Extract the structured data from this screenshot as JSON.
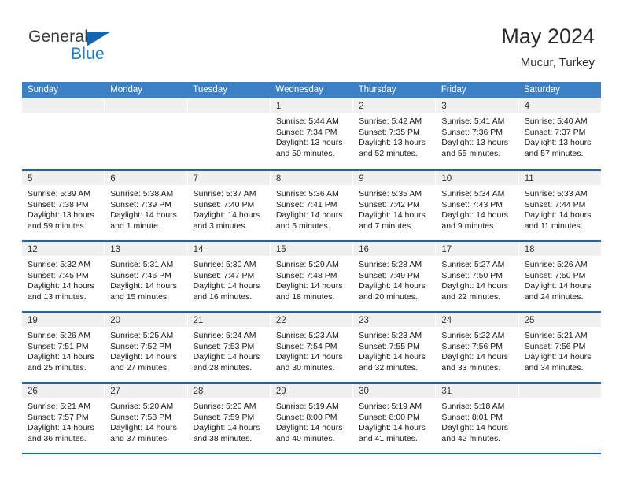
{
  "brand": {
    "name_top": "General",
    "name_bottom": "Blue",
    "triangle_color": "#1565b0",
    "blue_color": "#1c7fd4"
  },
  "header": {
    "title": "May 2024",
    "subtitle": "Mucur, Turkey"
  },
  "theme": {
    "header_row_bg": "#3b7fc4",
    "row_rule": "#1565b0",
    "day_band_bg": "#f0f0f0",
    "text": "#1a1a1a"
  },
  "weekdays": [
    "Sunday",
    "Monday",
    "Tuesday",
    "Wednesday",
    "Thursday",
    "Friday",
    "Saturday"
  ],
  "labels": {
    "sunrise_prefix": "Sunrise:",
    "sunset_prefix": "Sunset:",
    "daylight_prefix": "Daylight:"
  },
  "weeks": [
    [
      {
        "day": "",
        "empty": true
      },
      {
        "day": "",
        "empty": true
      },
      {
        "day": "",
        "empty": true
      },
      {
        "day": "1",
        "sunrise": "Sunrise: 5:44 AM",
        "sunset": "Sunset: 7:34 PM",
        "daylight_l1": "Daylight: 13 hours",
        "daylight_l2": "and 50 minutes."
      },
      {
        "day": "2",
        "sunrise": "Sunrise: 5:42 AM",
        "sunset": "Sunset: 7:35 PM",
        "daylight_l1": "Daylight: 13 hours",
        "daylight_l2": "and 52 minutes."
      },
      {
        "day": "3",
        "sunrise": "Sunrise: 5:41 AM",
        "sunset": "Sunset: 7:36 PM",
        "daylight_l1": "Daylight: 13 hours",
        "daylight_l2": "and 55 minutes."
      },
      {
        "day": "4",
        "sunrise": "Sunrise: 5:40 AM",
        "sunset": "Sunset: 7:37 PM",
        "daylight_l1": "Daylight: 13 hours",
        "daylight_l2": "and 57 minutes."
      }
    ],
    [
      {
        "day": "5",
        "sunrise": "Sunrise: 5:39 AM",
        "sunset": "Sunset: 7:38 PM",
        "daylight_l1": "Daylight: 13 hours",
        "daylight_l2": "and 59 minutes."
      },
      {
        "day": "6",
        "sunrise": "Sunrise: 5:38 AM",
        "sunset": "Sunset: 7:39 PM",
        "daylight_l1": "Daylight: 14 hours",
        "daylight_l2": "and 1 minute."
      },
      {
        "day": "7",
        "sunrise": "Sunrise: 5:37 AM",
        "sunset": "Sunset: 7:40 PM",
        "daylight_l1": "Daylight: 14 hours",
        "daylight_l2": "and 3 minutes."
      },
      {
        "day": "8",
        "sunrise": "Sunrise: 5:36 AM",
        "sunset": "Sunset: 7:41 PM",
        "daylight_l1": "Daylight: 14 hours",
        "daylight_l2": "and 5 minutes."
      },
      {
        "day": "9",
        "sunrise": "Sunrise: 5:35 AM",
        "sunset": "Sunset: 7:42 PM",
        "daylight_l1": "Daylight: 14 hours",
        "daylight_l2": "and 7 minutes."
      },
      {
        "day": "10",
        "sunrise": "Sunrise: 5:34 AM",
        "sunset": "Sunset: 7:43 PM",
        "daylight_l1": "Daylight: 14 hours",
        "daylight_l2": "and 9 minutes."
      },
      {
        "day": "11",
        "sunrise": "Sunrise: 5:33 AM",
        "sunset": "Sunset: 7:44 PM",
        "daylight_l1": "Daylight: 14 hours",
        "daylight_l2": "and 11 minutes."
      }
    ],
    [
      {
        "day": "12",
        "sunrise": "Sunrise: 5:32 AM",
        "sunset": "Sunset: 7:45 PM",
        "daylight_l1": "Daylight: 14 hours",
        "daylight_l2": "and 13 minutes."
      },
      {
        "day": "13",
        "sunrise": "Sunrise: 5:31 AM",
        "sunset": "Sunset: 7:46 PM",
        "daylight_l1": "Daylight: 14 hours",
        "daylight_l2": "and 15 minutes."
      },
      {
        "day": "14",
        "sunrise": "Sunrise: 5:30 AM",
        "sunset": "Sunset: 7:47 PM",
        "daylight_l1": "Daylight: 14 hours",
        "daylight_l2": "and 16 minutes."
      },
      {
        "day": "15",
        "sunrise": "Sunrise: 5:29 AM",
        "sunset": "Sunset: 7:48 PM",
        "daylight_l1": "Daylight: 14 hours",
        "daylight_l2": "and 18 minutes."
      },
      {
        "day": "16",
        "sunrise": "Sunrise: 5:28 AM",
        "sunset": "Sunset: 7:49 PM",
        "daylight_l1": "Daylight: 14 hours",
        "daylight_l2": "and 20 minutes."
      },
      {
        "day": "17",
        "sunrise": "Sunrise: 5:27 AM",
        "sunset": "Sunset: 7:50 PM",
        "daylight_l1": "Daylight: 14 hours",
        "daylight_l2": "and 22 minutes."
      },
      {
        "day": "18",
        "sunrise": "Sunrise: 5:26 AM",
        "sunset": "Sunset: 7:50 PM",
        "daylight_l1": "Daylight: 14 hours",
        "daylight_l2": "and 24 minutes."
      }
    ],
    [
      {
        "day": "19",
        "sunrise": "Sunrise: 5:26 AM",
        "sunset": "Sunset: 7:51 PM",
        "daylight_l1": "Daylight: 14 hours",
        "daylight_l2": "and 25 minutes."
      },
      {
        "day": "20",
        "sunrise": "Sunrise: 5:25 AM",
        "sunset": "Sunset: 7:52 PM",
        "daylight_l1": "Daylight: 14 hours",
        "daylight_l2": "and 27 minutes."
      },
      {
        "day": "21",
        "sunrise": "Sunrise: 5:24 AM",
        "sunset": "Sunset: 7:53 PM",
        "daylight_l1": "Daylight: 14 hours",
        "daylight_l2": "and 28 minutes."
      },
      {
        "day": "22",
        "sunrise": "Sunrise: 5:23 AM",
        "sunset": "Sunset: 7:54 PM",
        "daylight_l1": "Daylight: 14 hours",
        "daylight_l2": "and 30 minutes."
      },
      {
        "day": "23",
        "sunrise": "Sunrise: 5:23 AM",
        "sunset": "Sunset: 7:55 PM",
        "daylight_l1": "Daylight: 14 hours",
        "daylight_l2": "and 32 minutes."
      },
      {
        "day": "24",
        "sunrise": "Sunrise: 5:22 AM",
        "sunset": "Sunset: 7:56 PM",
        "daylight_l1": "Daylight: 14 hours",
        "daylight_l2": "and 33 minutes."
      },
      {
        "day": "25",
        "sunrise": "Sunrise: 5:21 AM",
        "sunset": "Sunset: 7:56 PM",
        "daylight_l1": "Daylight: 14 hours",
        "daylight_l2": "and 34 minutes."
      }
    ],
    [
      {
        "day": "26",
        "sunrise": "Sunrise: 5:21 AM",
        "sunset": "Sunset: 7:57 PM",
        "daylight_l1": "Daylight: 14 hours",
        "daylight_l2": "and 36 minutes."
      },
      {
        "day": "27",
        "sunrise": "Sunrise: 5:20 AM",
        "sunset": "Sunset: 7:58 PM",
        "daylight_l1": "Daylight: 14 hours",
        "daylight_l2": "and 37 minutes."
      },
      {
        "day": "28",
        "sunrise": "Sunrise: 5:20 AM",
        "sunset": "Sunset: 7:59 PM",
        "daylight_l1": "Daylight: 14 hours",
        "daylight_l2": "and 38 minutes."
      },
      {
        "day": "29",
        "sunrise": "Sunrise: 5:19 AM",
        "sunset": "Sunset: 8:00 PM",
        "daylight_l1": "Daylight: 14 hours",
        "daylight_l2": "and 40 minutes."
      },
      {
        "day": "30",
        "sunrise": "Sunrise: 5:19 AM",
        "sunset": "Sunset: 8:00 PM",
        "daylight_l1": "Daylight: 14 hours",
        "daylight_l2": "and 41 minutes."
      },
      {
        "day": "31",
        "sunrise": "Sunrise: 5:18 AM",
        "sunset": "Sunset: 8:01 PM",
        "daylight_l1": "Daylight: 14 hours",
        "daylight_l2": "and 42 minutes."
      },
      {
        "day": "",
        "empty": true
      }
    ]
  ]
}
